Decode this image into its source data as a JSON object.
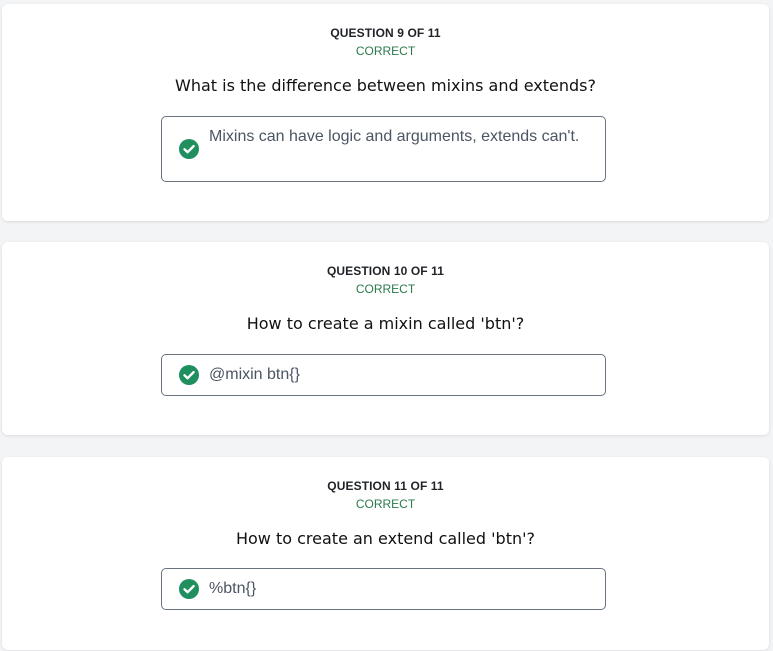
{
  "questions": [
    {
      "number_label": "QUESTION 9 OF 11",
      "status": "CORRECT",
      "question": "What is the difference between mixins and extends?",
      "answer": "Mixins can have logic and arguments, extends can't."
    },
    {
      "number_label": "QUESTION 10 OF 11",
      "status": "CORRECT",
      "question": "How to create a mixin called 'btn'?",
      "answer": "@mixin btn{}"
    },
    {
      "number_label": "QUESTION 11 OF 11",
      "status": "CORRECT",
      "question": "How to create an extend called 'btn'?",
      "answer": "%btn{}"
    }
  ],
  "colors": {
    "correct_green": "#2b7a4b",
    "check_fill": "#1f8f5f"
  },
  "icons": {
    "answer_status": "check-circle-icon"
  }
}
